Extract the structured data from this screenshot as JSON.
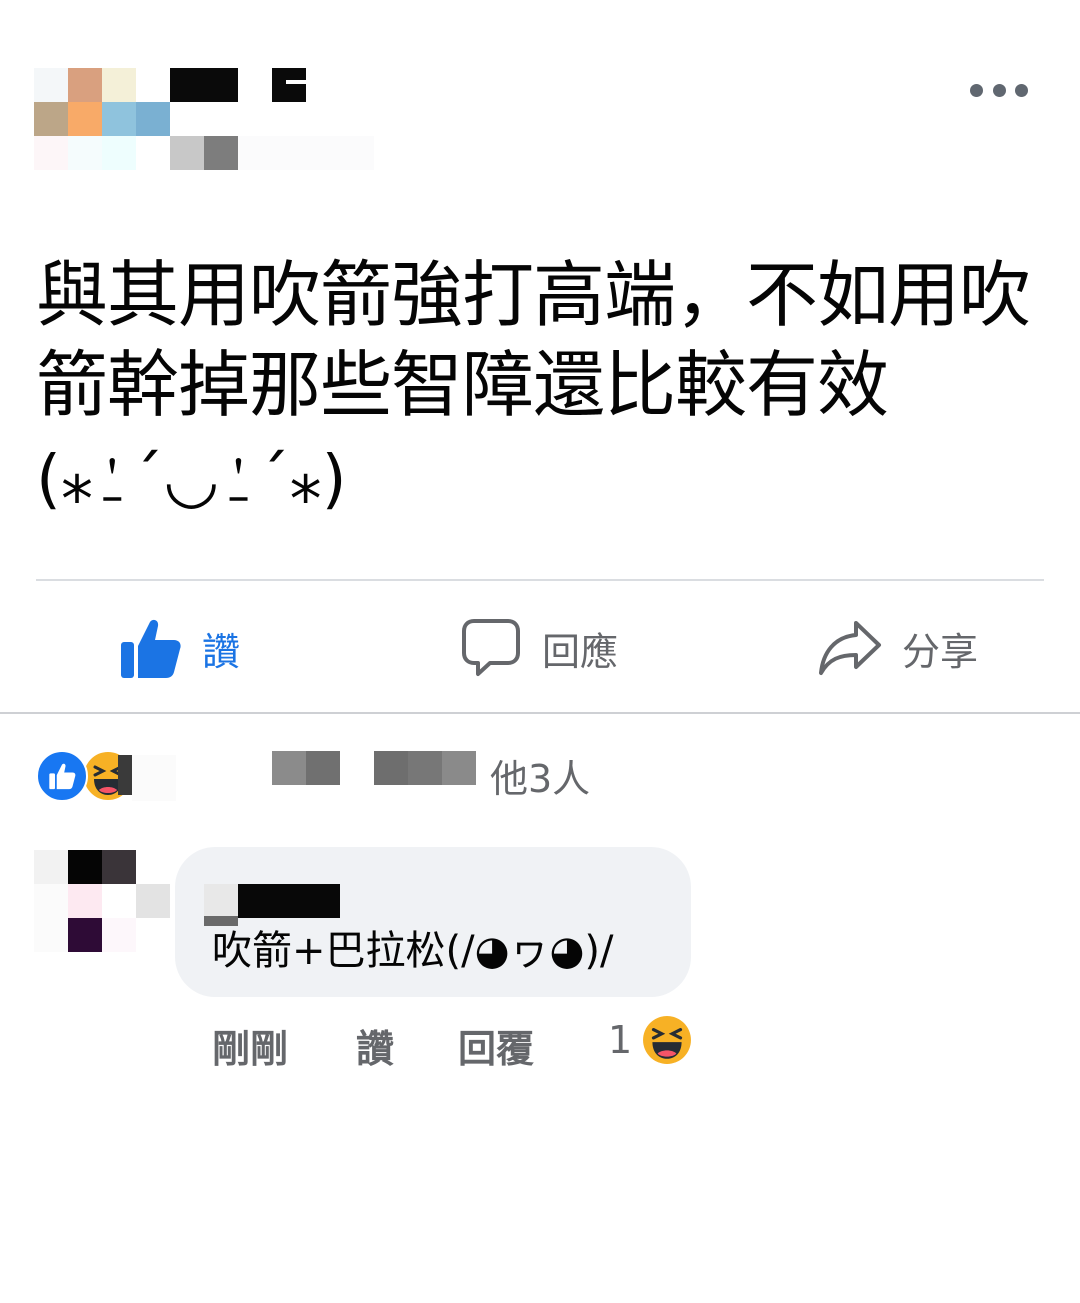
{
  "post": {
    "body": "與其用吹箭強打高端，不如用吹箭幹掉那些智障還比較有效",
    "emoticon": "(⁎⍘ˊ◡⍘ˊ⁎)"
  },
  "actions": {
    "like": "讚",
    "comment": "回應",
    "share": "分享"
  },
  "reactions": {
    "summary": "他3人",
    "icons": [
      "like-icon",
      "haha-icon"
    ]
  },
  "comment": {
    "text": "吹箭+巴拉松(/◕ヮ◕)/",
    "time": "剛剛",
    "like": "讚",
    "reply": "回覆",
    "reaction_count": "1",
    "reaction_icon": "haha-icon"
  },
  "colors": {
    "accent": "#1b74e4",
    "muted": "#65676b",
    "bubble": "#f0f2f5"
  }
}
